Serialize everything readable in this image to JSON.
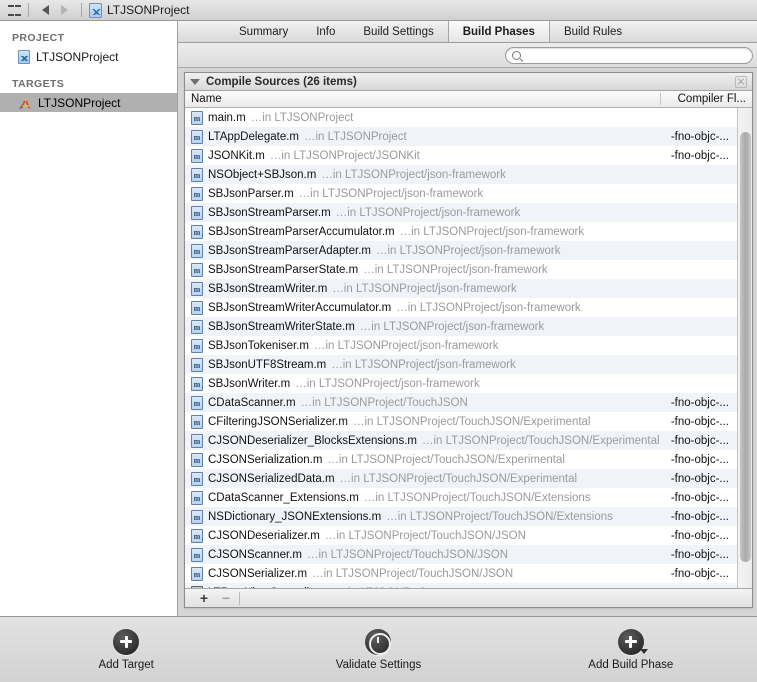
{
  "topbar": {
    "grid_icon": "grid-icon",
    "back_icon": "back-arrow-icon",
    "forward_icon": "forward-arrow-icon",
    "project_icon": "project-document-icon",
    "title": "LTJSONProject"
  },
  "sidebar": {
    "project_group_label": "PROJECT",
    "project_items": [
      {
        "label": "LTJSONProject",
        "icon": "project-document-icon"
      }
    ],
    "targets_group_label": "TARGETS",
    "target_items": [
      {
        "label": "LTJSONProject",
        "icon": "target-app-icon",
        "selected": true
      }
    ]
  },
  "tabs": [
    {
      "label": "Summary",
      "active": false
    },
    {
      "label": "Info",
      "active": false
    },
    {
      "label": "Build Settings",
      "active": false
    },
    {
      "label": "Build Phases",
      "active": true
    },
    {
      "label": "Build Rules",
      "active": false
    }
  ],
  "search": {
    "value": "",
    "placeholder": "",
    "icon": "search-icon"
  },
  "phase": {
    "title": "Compile Sources (26 items)",
    "disclosure_icon": "disclosure-triangle-down-icon",
    "close_icon": "close-icon",
    "columns": {
      "name": "Name",
      "flags": "Compiler Fl..."
    },
    "add_label": "+",
    "remove_label": "−",
    "files": [
      {
        "name": "main.m",
        "path": "…in LTJSONProject",
        "flags": ""
      },
      {
        "name": "LTAppDelegate.m",
        "path": "…in LTJSONProject",
        "flags": "-fno-objc-..."
      },
      {
        "name": "JSONKit.m",
        "path": "…in LTJSONProject/JSONKit",
        "flags": "-fno-objc-..."
      },
      {
        "name": "NSObject+SBJson.m",
        "path": "…in LTJSONProject/json-framework",
        "flags": ""
      },
      {
        "name": "SBJsonParser.m",
        "path": "…in LTJSONProject/json-framework",
        "flags": ""
      },
      {
        "name": "SBJsonStreamParser.m",
        "path": "…in LTJSONProject/json-framework",
        "flags": ""
      },
      {
        "name": "SBJsonStreamParserAccumulator.m",
        "path": "…in LTJSONProject/json-framework",
        "flags": ""
      },
      {
        "name": "SBJsonStreamParserAdapter.m",
        "path": "…in LTJSONProject/json-framework",
        "flags": ""
      },
      {
        "name": "SBJsonStreamParserState.m",
        "path": "…in LTJSONProject/json-framework",
        "flags": ""
      },
      {
        "name": "SBJsonStreamWriter.m",
        "path": "…in LTJSONProject/json-framework",
        "flags": ""
      },
      {
        "name": "SBJsonStreamWriterAccumulator.m",
        "path": "…in LTJSONProject/json-framework",
        "flags": ""
      },
      {
        "name": "SBJsonStreamWriterState.m",
        "path": "…in LTJSONProject/json-framework",
        "flags": ""
      },
      {
        "name": "SBJsonTokeniser.m",
        "path": "…in LTJSONProject/json-framework",
        "flags": ""
      },
      {
        "name": "SBJsonUTF8Stream.m",
        "path": "…in LTJSONProject/json-framework",
        "flags": ""
      },
      {
        "name": "SBJsonWriter.m",
        "path": "…in LTJSONProject/json-framework",
        "flags": ""
      },
      {
        "name": "CDataScanner.m",
        "path": "…in LTJSONProject/TouchJSON",
        "flags": "-fno-objc-..."
      },
      {
        "name": "CFilteringJSONSerializer.m",
        "path": "…in LTJSONProject/TouchJSON/Experimental",
        "flags": "-fno-objc-..."
      },
      {
        "name": "CJSONDeserializer_BlocksExtensions.m",
        "path": "…in LTJSONProject/TouchJSON/Experimental",
        "flags": "-fno-objc-..."
      },
      {
        "name": "CJSONSerialization.m",
        "path": "…in LTJSONProject/TouchJSON/Experimental",
        "flags": "-fno-objc-..."
      },
      {
        "name": "CJSONSerializedData.m",
        "path": "…in LTJSONProject/TouchJSON/Experimental",
        "flags": "-fno-objc-..."
      },
      {
        "name": "CDataScanner_Extensions.m",
        "path": "…in LTJSONProject/TouchJSON/Extensions",
        "flags": "-fno-objc-..."
      },
      {
        "name": "NSDictionary_JSONExtensions.m",
        "path": "…in LTJSONProject/TouchJSON/Extensions",
        "flags": "-fno-objc-..."
      },
      {
        "name": "CJSONDeserializer.m",
        "path": "…in LTJSONProject/TouchJSON/JSON",
        "flags": "-fno-objc-..."
      },
      {
        "name": "CJSONScanner.m",
        "path": "…in LTJSONProject/TouchJSON/JSON",
        "flags": "-fno-objc-..."
      },
      {
        "name": "CJSONSerializer.m",
        "path": "…in LTJSONProject/TouchJSON/JSON",
        "flags": "-fno-objc-..."
      },
      {
        "name": "LTRootViewController.m",
        "path": "…in LTJSONProject",
        "flags": "",
        "icon_dark": true
      }
    ]
  },
  "bottom_toolbar": [
    {
      "label": "Add Target",
      "icon": "add-circle-icon",
      "caret": false
    },
    {
      "label": "Validate Settings",
      "icon": "clock-circle-icon",
      "caret": false
    },
    {
      "label": "Add Build Phase",
      "icon": "add-circle-icon",
      "caret": true
    }
  ]
}
